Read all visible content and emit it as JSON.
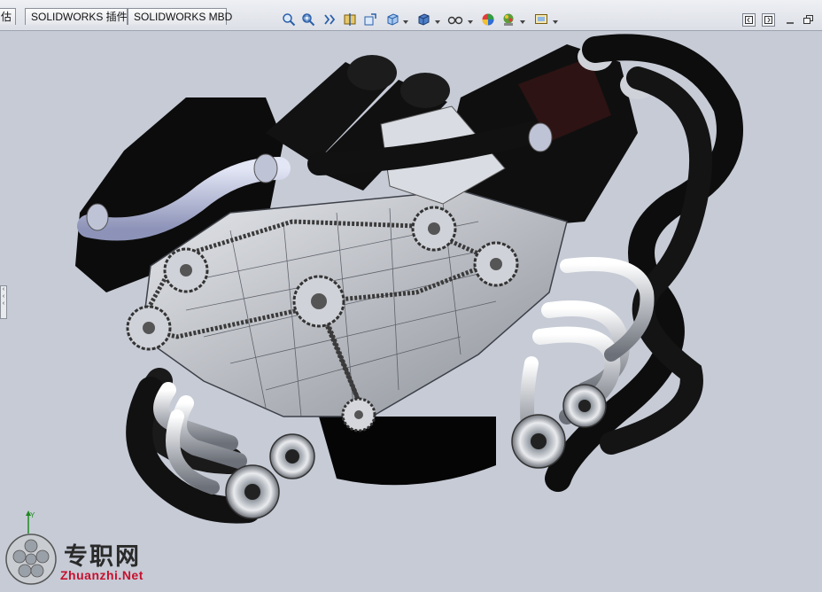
{
  "tabs": [
    {
      "label": "估"
    },
    {
      "label": "SOLIDWORKS 插件"
    },
    {
      "label": "SOLIDWORKS MBD"
    }
  ],
  "toolbar": {
    "icons": [
      "zoom-to-fit-icon",
      "zoom-area-icon",
      "previous-view-icon",
      "section-view-icon",
      "dynamic-annotation-icon",
      "view-orientation-icon",
      "display-style-icon",
      "hide-show-items-icon",
      "edit-appearance-icon",
      "apply-scene-icon",
      "view-settings-icon"
    ]
  },
  "window_controls": [
    "tile-left-icon",
    "tile-right-icon",
    "minimize-icon",
    "restore-icon"
  ],
  "viewport": {
    "background": "#c6cbd6",
    "model": "engine-assembly",
    "triad_axis": "Y"
  },
  "watermark": {
    "cn_text": "专职网",
    "en_text": "Zhuanzhi.Net"
  }
}
